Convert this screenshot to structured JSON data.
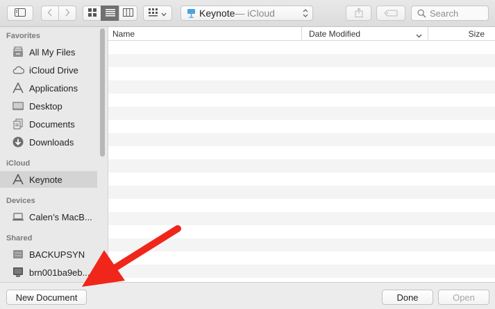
{
  "toolbar": {
    "location_title": "Keynote",
    "location_suffix": " — iCloud",
    "search_placeholder": "Search"
  },
  "sidebar": {
    "sections": [
      {
        "heading": "Favorites",
        "items": [
          {
            "label": "All My Files",
            "icon": "all-files-icon"
          },
          {
            "label": "iCloud Drive",
            "icon": "cloud-icon"
          },
          {
            "label": "Applications",
            "icon": "applications-icon"
          },
          {
            "label": "Desktop",
            "icon": "desktop-icon"
          },
          {
            "label": "Documents",
            "icon": "documents-icon"
          },
          {
            "label": "Downloads",
            "icon": "downloads-icon"
          }
        ]
      },
      {
        "heading": "iCloud",
        "items": [
          {
            "label": "Keynote",
            "icon": "keynote-icon",
            "selected": true
          }
        ]
      },
      {
        "heading": "Devices",
        "items": [
          {
            "label": "Calen’s MacB...",
            "icon": "laptop-icon"
          }
        ]
      },
      {
        "heading": "Shared",
        "items": [
          {
            "label": "BACKUPSYN",
            "icon": "server-icon"
          },
          {
            "label": "brn001ba9eb...",
            "icon": "monitor-icon"
          }
        ]
      }
    ]
  },
  "columns": {
    "name": "Name",
    "date_modified": "Date Modified",
    "size": "Size"
  },
  "footer": {
    "new_document": "New Document",
    "done": "Done",
    "open": "Open"
  },
  "colors": {
    "annotation_arrow": "#f0261b",
    "selected_row": "#d4d4d4"
  }
}
